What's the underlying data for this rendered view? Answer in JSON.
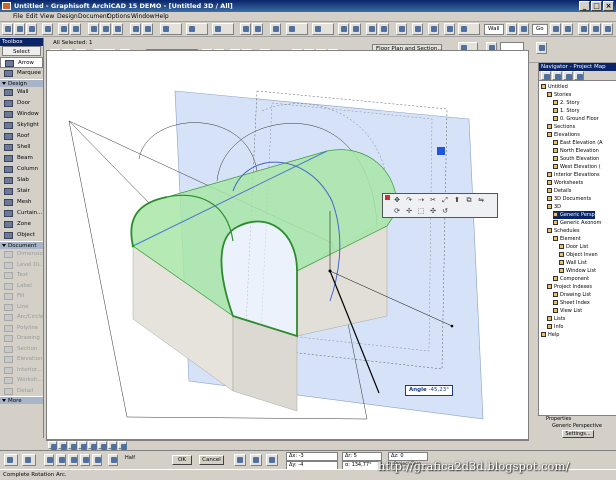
{
  "window": {
    "title": "Untitled - Graphisoft ArchiCAD 15 DEMO - [Untitled 3D / All]",
    "minimize": "_",
    "maximize": "□",
    "close": "×"
  },
  "menu": [
    "File",
    "Edit",
    "View",
    "Design",
    "Document",
    "Options",
    "Window",
    "Help"
  ],
  "toolbar": {
    "selection_info": "All Selected: 1",
    "element_type": "Shell - General",
    "floor_plan_button": "Floor Plan and Section...",
    "goto_label": "Go",
    "zoom_value": "Wall"
  },
  "toolbox": {
    "title": "Toolbox",
    "select_label": "Select",
    "arrow_label": "Arrow",
    "marquee_label": "Marquee",
    "design_group": "Design",
    "design_tools": [
      "Wall",
      "Door",
      "Window",
      "Skylight",
      "Roof",
      "Shell",
      "Beam",
      "Column",
      "Slab",
      "Stair",
      "Mesh",
      "Curtain...",
      "Zone",
      "Object"
    ],
    "document_group": "Document",
    "document_tools": [
      "Dimension",
      "Level Di...",
      "Text",
      "Label",
      "Fill",
      "Line",
      "Arc/Circle",
      "Polyline",
      "Drawing",
      "Section",
      "Elevation",
      "Interior...",
      "Worksh...",
      "Detail"
    ],
    "more_label": "More"
  },
  "view_tab": {
    "label": "Untitled 3D / All"
  },
  "pet_palette": {
    "angle_label": "Angle",
    "angle_value": "-45,23°"
  },
  "navigator": {
    "title": "Navigator - Project Map",
    "items": [
      {
        "label": "Untitled",
        "level": 0
      },
      {
        "label": "Stories",
        "level": 1
      },
      {
        "label": "2. Story",
        "level": 2
      },
      {
        "label": "1. Story",
        "level": 2
      },
      {
        "label": "0. Ground Floor",
        "level": 2
      },
      {
        "label": "Sections",
        "level": 1
      },
      {
        "label": "Elevations",
        "level": 1
      },
      {
        "label": "East Elevation (A",
        "level": 2
      },
      {
        "label": "North Elevation",
        "level": 2
      },
      {
        "label": "South Elevation",
        "level": 2
      },
      {
        "label": "West Elevation (",
        "level": 2
      },
      {
        "label": "Interior Elevations",
        "level": 1
      },
      {
        "label": "Worksheets",
        "level": 1
      },
      {
        "label": "Details",
        "level": 1
      },
      {
        "label": "3D Documents",
        "level": 1
      },
      {
        "label": "3D",
        "level": 1
      },
      {
        "label": "Generic Persp",
        "level": 2,
        "selected": true
      },
      {
        "label": "Generic Axonom",
        "level": 2
      },
      {
        "label": "Schedules",
        "level": 1
      },
      {
        "label": "Element",
        "level": 2
      },
      {
        "label": "Door List",
        "level": 3
      },
      {
        "label": "Object Inven",
        "level": 3
      },
      {
        "label": "Wall List",
        "level": 3
      },
      {
        "label": "Window List",
        "level": 3
      },
      {
        "label": "Component",
        "level": 2
      },
      {
        "label": "Project Indexes",
        "level": 1
      },
      {
        "label": "Drawing List",
        "level": 2
      },
      {
        "label": "Sheet Index",
        "level": 2
      },
      {
        "label": "View List",
        "level": 2
      },
      {
        "label": "Lists",
        "level": 1
      },
      {
        "label": "Info",
        "level": 1
      },
      {
        "label": "Help",
        "level": 0
      }
    ]
  },
  "properties": {
    "title": "Properties",
    "view_name": "Generic Perspective",
    "settings_button": "Settings..."
  },
  "bottom": {
    "ok_label": "OK",
    "cancel_label": "Cancel",
    "half_label": "Half",
    "dx_label": "Δx: -3",
    "dy_label": "Δy: -4",
    "dr_label": "Δr: 5",
    "angle_label": "α: 134,77°",
    "dz_label": "Δz: 0",
    "ref_label": "to Project Zero"
  },
  "status": {
    "text": "Complete Rotation Arc."
  },
  "watermark": {
    "text": "http://grafica2d3d.blogspot.com/"
  },
  "colors": {
    "title_bar": "#0a246a",
    "shell_green": "#6fcf6f",
    "plane_blue": "#c8d8f4",
    "accent_blue": "#2255dd"
  }
}
